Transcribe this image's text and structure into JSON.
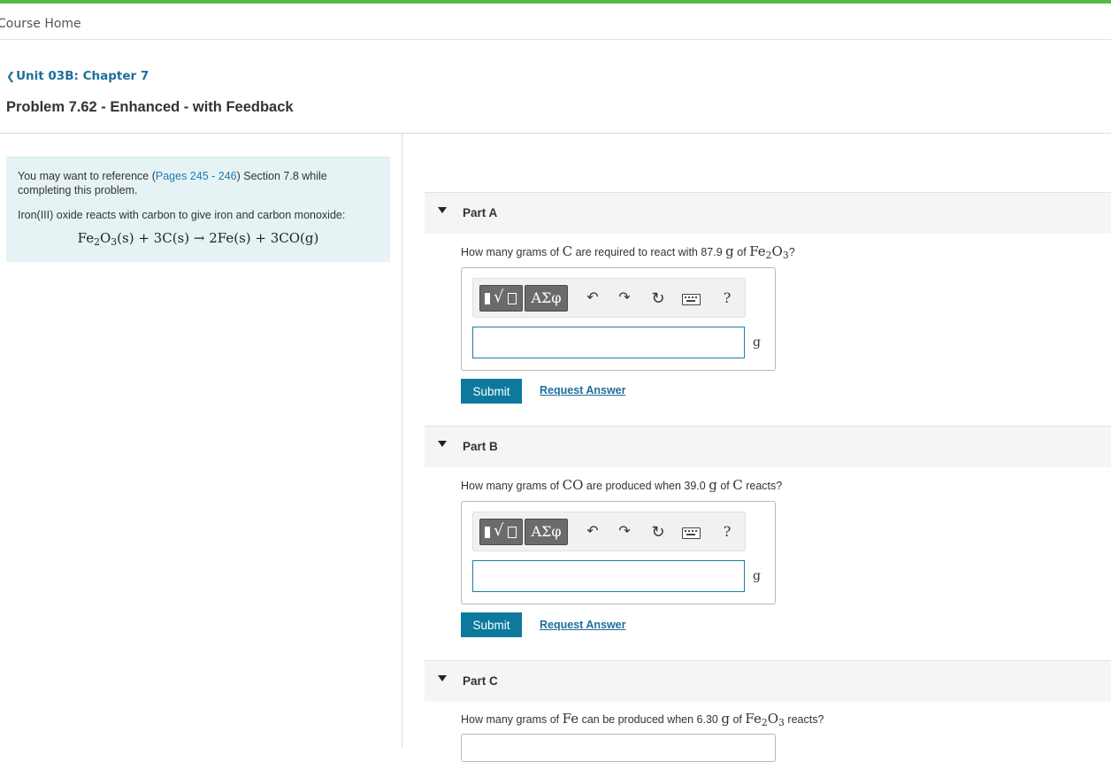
{
  "nav": {
    "course_home": "Course Home",
    "back_link": "Unit 03B: Chapter 7"
  },
  "problem": {
    "title": "Problem 7.62 - Enhanced - with Feedback"
  },
  "reference": {
    "prefix": "You may want to reference (",
    "link": "Pages 245 - 246",
    "suffix": ") Section 7.8 while completing this problem.",
    "intro": "Iron(III) oxide reacts with carbon to give iron and carbon monoxide:",
    "equation": "Fe2O3(s) + 3C(s) → 2Fe(s) + 3CO(g)"
  },
  "toolbar": {
    "greek_label": "ΑΣφ",
    "icons": [
      "templates-icon",
      "greek-symbols-icon",
      "undo-icon",
      "redo-icon",
      "reset-icon",
      "keyboard-icon",
      "help-icon"
    ],
    "help_label": "?"
  },
  "parts": [
    {
      "label": "Part A",
      "question": {
        "t1": "How many grams of",
        "sub1": "C",
        "t2": "are required to react with 87.9",
        "u": "g",
        "t3": "of",
        "sub2": "Fe2O3",
        "t4": "?"
      },
      "answer_value": "",
      "unit": "g",
      "submit": "Submit",
      "request": "Request Answer"
    },
    {
      "label": "Part B",
      "question": {
        "t1": "How many grams of",
        "sub1": "CO",
        "t2": "are produced when 39.0",
        "u": "g",
        "t3": "of",
        "sub2": "C",
        "t4": "reacts?"
      },
      "answer_value": "",
      "unit": "g",
      "submit": "Submit",
      "request": "Request Answer"
    },
    {
      "label": "Part C",
      "question": {
        "t1": "How many grams of",
        "sub1": "Fe",
        "t2": "can be produced when 6.30",
        "u": "g",
        "t3": "of",
        "sub2": "Fe2O3",
        "t4": "reacts?"
      }
    }
  ]
}
